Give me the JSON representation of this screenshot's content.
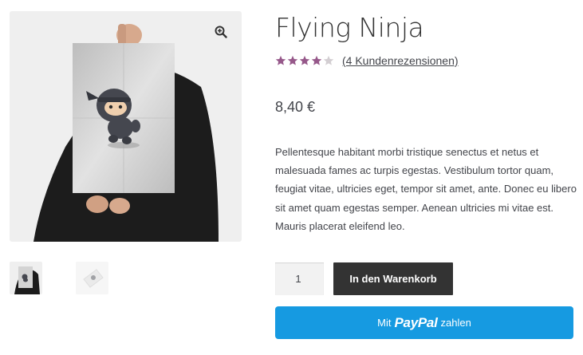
{
  "product": {
    "title": "Flying Ninja",
    "rating_value": 4,
    "rating_max": 5,
    "review_link": "(4 Kundenrezensionen)",
    "price": "8,40 €",
    "description": "Pellentesque habitant morbi tristique senectus et netus et malesuada fames ac turpis egestas. Vestibulum tortor quam, feugiat vitae, ultricies eget, tempor sit amet, ante. Donec eu libero sit amet quam egestas semper. Aenean ultricies mi vitae est. Mauris placerat eleifend leo."
  },
  "gallery": {
    "zoom_icon": "magnifier-plus-icon",
    "thumbnails": [
      "poster-held-by-person",
      "poster-flat"
    ]
  },
  "cart": {
    "quantity": "1",
    "add_to_cart_label": "In den Warenkorb"
  },
  "paypal": {
    "prefix": "Mit",
    "brand_pay": "Pay",
    "brand_pal": "Pal",
    "suffix": "zahlen"
  },
  "colors": {
    "star": "#96588a",
    "star_empty": "#d3ced2",
    "dark_button": "#333333",
    "paypal_button": "#169ae1"
  }
}
